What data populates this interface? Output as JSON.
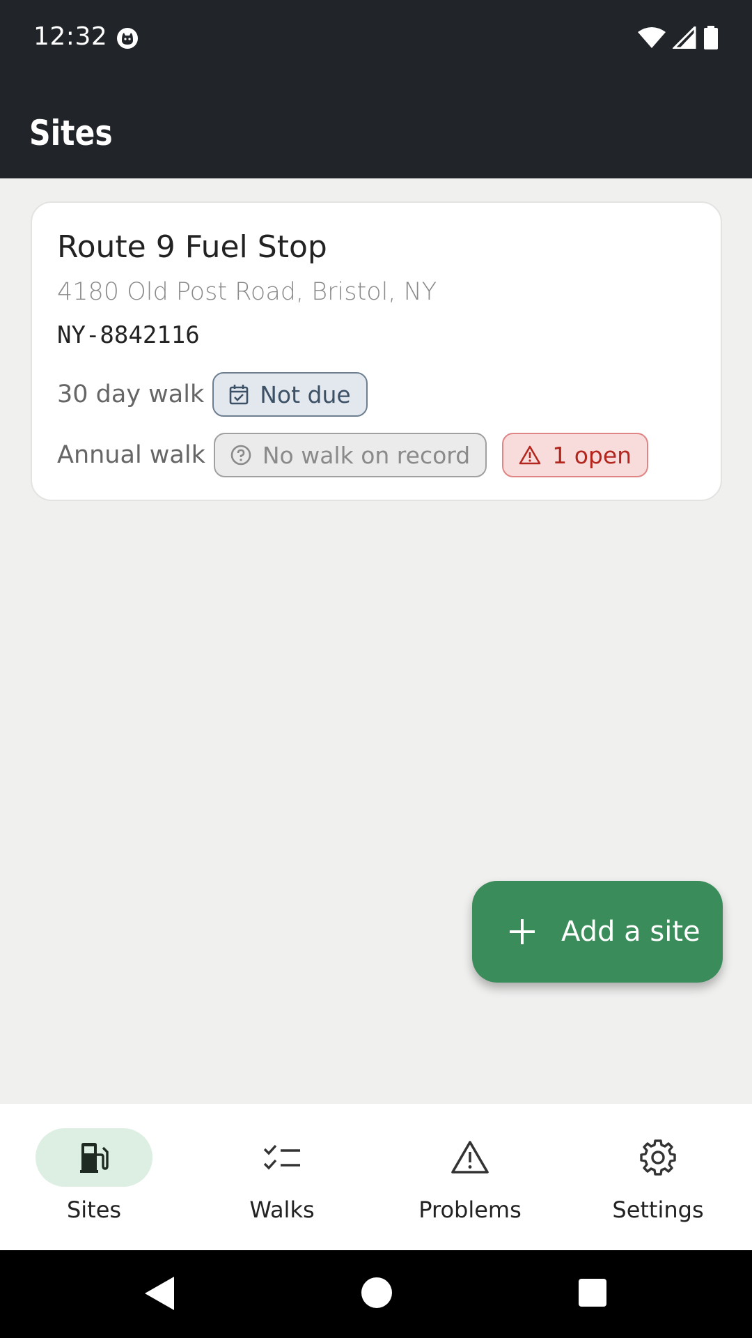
{
  "status_bar": {
    "time": "12:32"
  },
  "app_bar": {
    "title": "Sites"
  },
  "site_card": {
    "name": "Route 9 Fuel Stop",
    "address": "4180 Old Post Road, Bristol, NY",
    "site_id": "NY-8842116",
    "walk_30_day": {
      "label": "30 day walk",
      "status": "Not due",
      "status_icon": "calendar-check-icon"
    },
    "walk_annual": {
      "label": "Annual walk",
      "status": "No walk on record",
      "status_icon": "question-circle-icon"
    },
    "problems_badge": {
      "text": "1 open",
      "icon": "warning-triangle-icon"
    }
  },
  "fab": {
    "label": "Add a site",
    "icon": "plus-icon",
    "color": "#3a8d5a"
  },
  "bottom_nav": {
    "items": [
      {
        "label": "Sites",
        "icon": "fuel-pump-icon",
        "active": true
      },
      {
        "label": "Walks",
        "icon": "checklist-icon",
        "active": false
      },
      {
        "label": "Problems",
        "icon": "warning-triangle-icon",
        "active": false
      },
      {
        "label": "Settings",
        "icon": "gear-icon",
        "active": false
      }
    ]
  },
  "colors": {
    "header_bg": "#212529",
    "accent": "#3a8d5a",
    "danger": "#b3261e"
  }
}
